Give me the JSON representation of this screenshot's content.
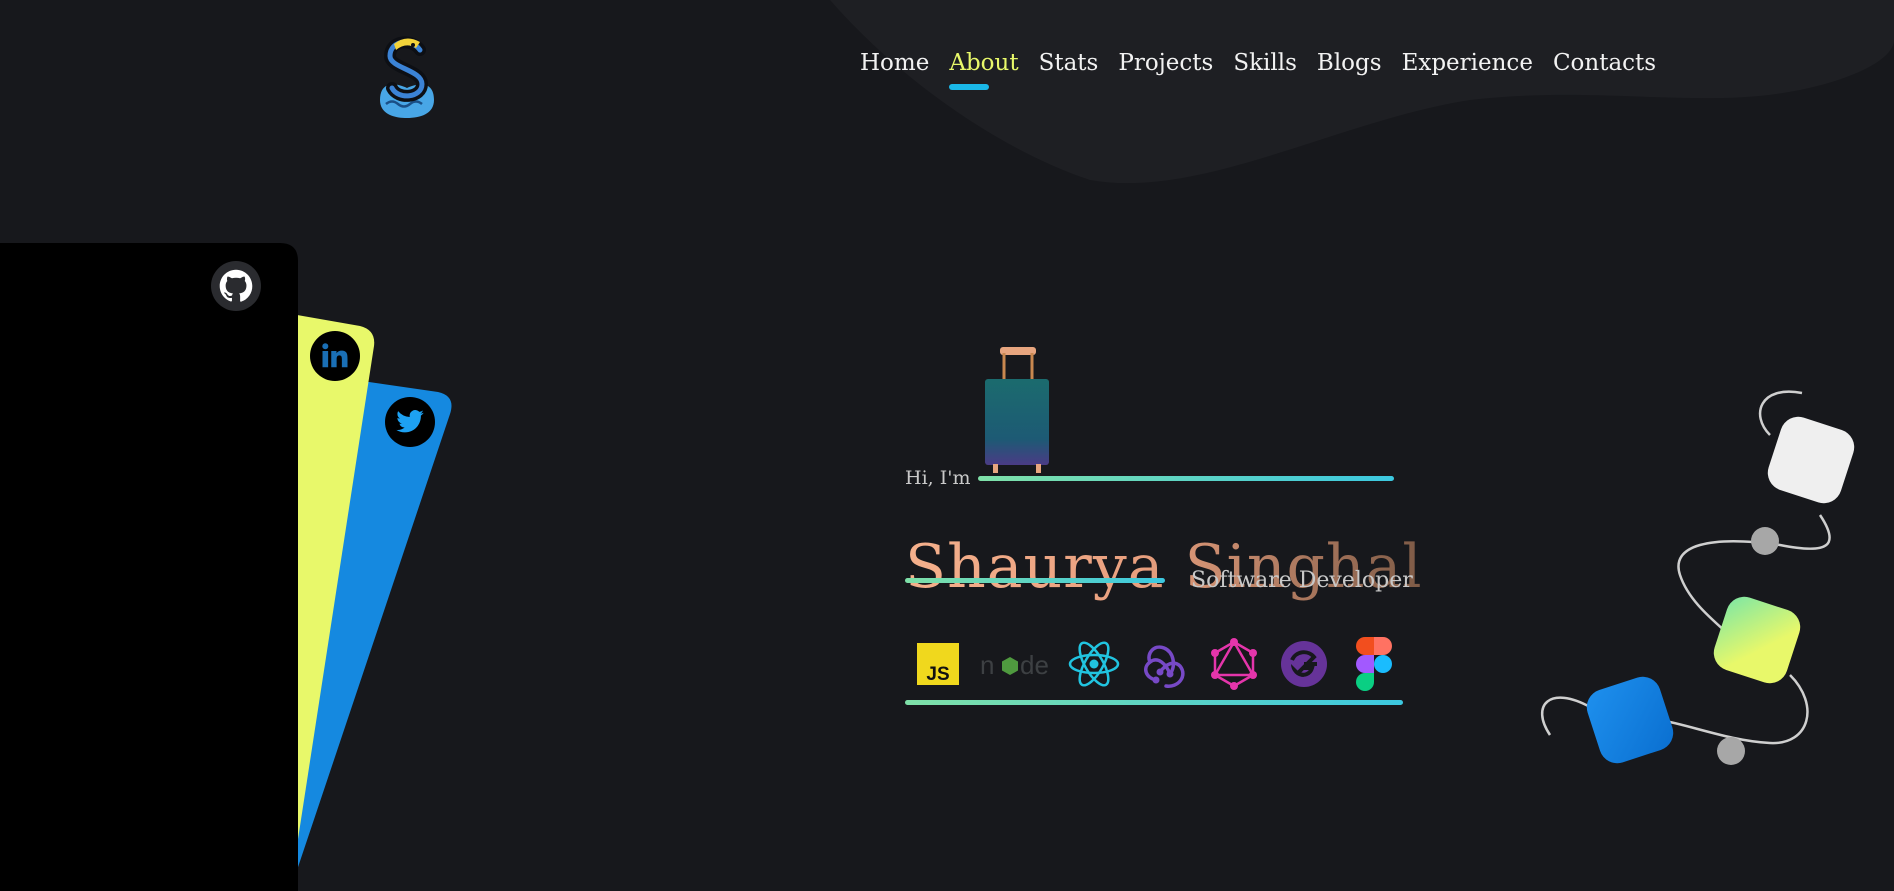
{
  "header": {
    "logo_icon": "dragon-s-logo-icon",
    "nav": [
      {
        "label": "Home",
        "active": false
      },
      {
        "label": "About",
        "active": true
      },
      {
        "label": "Stats",
        "active": false
      },
      {
        "label": "Projects",
        "active": false
      },
      {
        "label": "Skills",
        "active": false
      },
      {
        "label": "Blogs",
        "active": false
      },
      {
        "label": "Experience",
        "active": false
      },
      {
        "label": "Contacts",
        "active": false
      }
    ]
  },
  "social": [
    {
      "name": "github",
      "icon": "github-icon",
      "card_color": "#000000"
    },
    {
      "name": "linkedin",
      "icon": "linkedin-icon",
      "card_color": "#e8f86a"
    },
    {
      "name": "twitter",
      "icon": "twitter-icon",
      "card_color": "#1589e0"
    }
  ],
  "hero": {
    "greeting": "Hi, I'm",
    "name": "Shaurya Singhal",
    "role": "Software Developer",
    "illustration": "suitcase-icon",
    "tech_icons": [
      "javascript-icon",
      "nodejs-icon",
      "react-icon",
      "redux-icon",
      "graphql-icon",
      "gatsby-icon",
      "figma-icon"
    ]
  },
  "colors": {
    "background": "#17181c",
    "accent_yellow": "#e8f86a",
    "accent_blue": "#1ab8e8",
    "name_gradient_start": "#f5b08c",
    "name_gradient_end": "#7d5a46"
  }
}
